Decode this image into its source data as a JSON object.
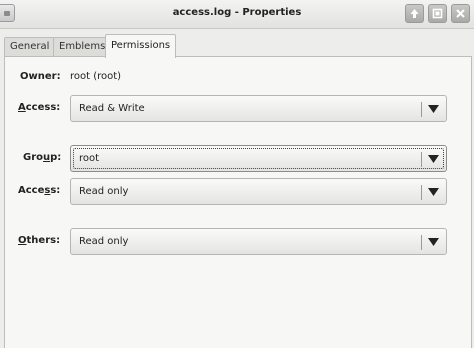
{
  "window": {
    "title": "access.log - Properties"
  },
  "tabs": [
    {
      "label": "General"
    },
    {
      "label": "Emblems"
    },
    {
      "label": "Permissions"
    }
  ],
  "permissions": {
    "owner_label": "Owner:",
    "owner_value": "root (root)",
    "owner_access": {
      "label_pre": "",
      "label_ul": "A",
      "label_post": "ccess:",
      "value": "Read & Write"
    },
    "group": {
      "label_pre": "Gro",
      "label_ul": "u",
      "label_post": "p:",
      "value": "root"
    },
    "group_access": {
      "label_pre": "Acce",
      "label_ul": "s",
      "label_post": "s:",
      "value": "Read only"
    },
    "others": {
      "label_pre": "",
      "label_ul": "O",
      "label_post": "thers:",
      "value": "Read only"
    }
  },
  "icons": {
    "app": "folder-icon",
    "up": "arrow-up-icon",
    "maximize": "maximize-icon",
    "close": "close-icon",
    "dropdown": "triangle-down-icon"
  }
}
